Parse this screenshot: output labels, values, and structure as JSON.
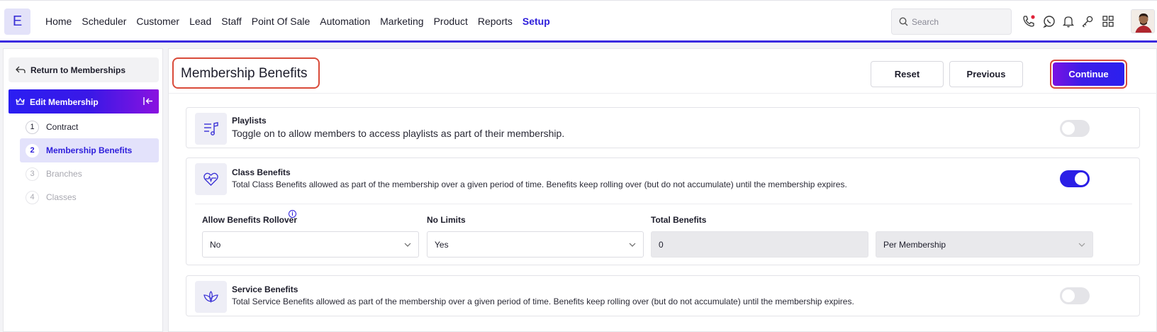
{
  "app": {
    "logo_letter": "E"
  },
  "nav": [
    "Home",
    "Scheduler",
    "Customer",
    "Lead",
    "Staff",
    "Point Of Sale",
    "Automation",
    "Marketing",
    "Product",
    "Reports",
    "Setup"
  ],
  "nav_active": "Setup",
  "search": {
    "placeholder": "Search"
  },
  "sidebar": {
    "back_label": "Return to Memberships",
    "section_label": "Edit Membership",
    "steps": [
      {
        "num": "1",
        "label": "Contract",
        "state": "done"
      },
      {
        "num": "2",
        "label": "Membership Benefits",
        "state": "active"
      },
      {
        "num": "3",
        "label": "Branches",
        "state": "muted"
      },
      {
        "num": "4",
        "label": "Classes",
        "state": "muted"
      }
    ]
  },
  "main": {
    "title": "Membership Benefits",
    "buttons": {
      "reset": "Reset",
      "previous": "Previous",
      "continue": "Continue"
    }
  },
  "cards": {
    "playlists": {
      "title": "Playlists",
      "description": "Toggle on to allow members to access playlists as part of their membership.",
      "enabled": false
    },
    "class_benefits": {
      "title": "Class Benefits",
      "description": "Total Class Benefits allowed as part of the membership over a given period of time. Benefits keep rolling over (but do not accumulate) until the membership expires.",
      "enabled": true,
      "fields": {
        "rollover_label": "Allow Benefits Rollover",
        "rollover_value": "No",
        "no_limits_label": "No Limits",
        "no_limits_value": "Yes",
        "total_label": "Total Benefits",
        "total_value": "0",
        "period_value": "Per Membership"
      }
    },
    "service_benefits": {
      "title": "Service Benefits",
      "description": "Total Service Benefits allowed as part of the membership over a given period of time. Benefits keep rolling over (but do not accumulate) until the membership expires.",
      "enabled": false
    }
  },
  "colors": {
    "accent": "#2d1ddb",
    "highlight": "#d94b3a"
  }
}
